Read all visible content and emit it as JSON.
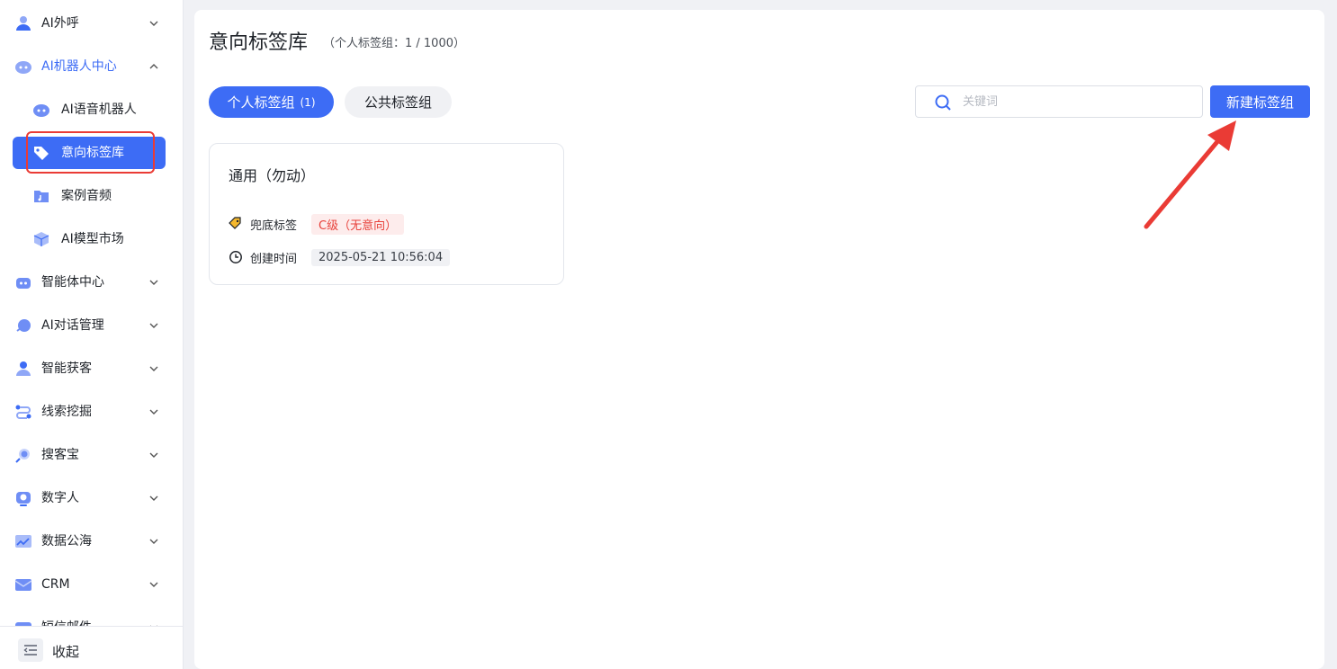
{
  "sidebar": {
    "items": [
      {
        "label": "AI外呼",
        "icon": "user-icon"
      },
      {
        "label": "AI机器人中心",
        "icon": "robot-icon"
      },
      {
        "label": "AI语音机器人",
        "icon": "robot-face-icon"
      },
      {
        "label": "意向标签库",
        "icon": "tag-icon"
      },
      {
        "label": "案例音频",
        "icon": "audio-folder-icon"
      },
      {
        "label": "AI模型市场",
        "icon": "cube-icon"
      },
      {
        "label": "智能体中心",
        "icon": "agent-icon"
      },
      {
        "label": "AI对话管理",
        "icon": "chat-icon"
      },
      {
        "label": "智能获客",
        "icon": "customer-icon"
      },
      {
        "label": "线索挖掘",
        "icon": "flow-icon"
      },
      {
        "label": "搜客宝",
        "icon": "search-people-icon"
      },
      {
        "label": "数字人",
        "icon": "digital-human-icon"
      },
      {
        "label": "数据公海",
        "icon": "chart-icon"
      },
      {
        "label": "CRM",
        "icon": "mail-icon"
      },
      {
        "label": "短信邮件",
        "icon": "message-icon"
      }
    ],
    "collapse_label": "收起"
  },
  "page": {
    "title": "意向标签库",
    "subtitle": "（个人标签组：1 / 1000）"
  },
  "tabs": {
    "personal_label": "个人标签组",
    "personal_count": "(1)",
    "public_label": "公共标签组"
  },
  "search": {
    "placeholder": "关键词",
    "value": ""
  },
  "new_button_label": "新建标签组",
  "card": {
    "title": "通用（勿动）",
    "fallback_label": "兜底标签",
    "fallback_value": "C级（无意向）",
    "created_label": "创建时间",
    "created_value": "2025-05-21 10:56:04"
  },
  "colors": {
    "accent": "#3d6cf5",
    "highlight": "#ea3b35"
  }
}
